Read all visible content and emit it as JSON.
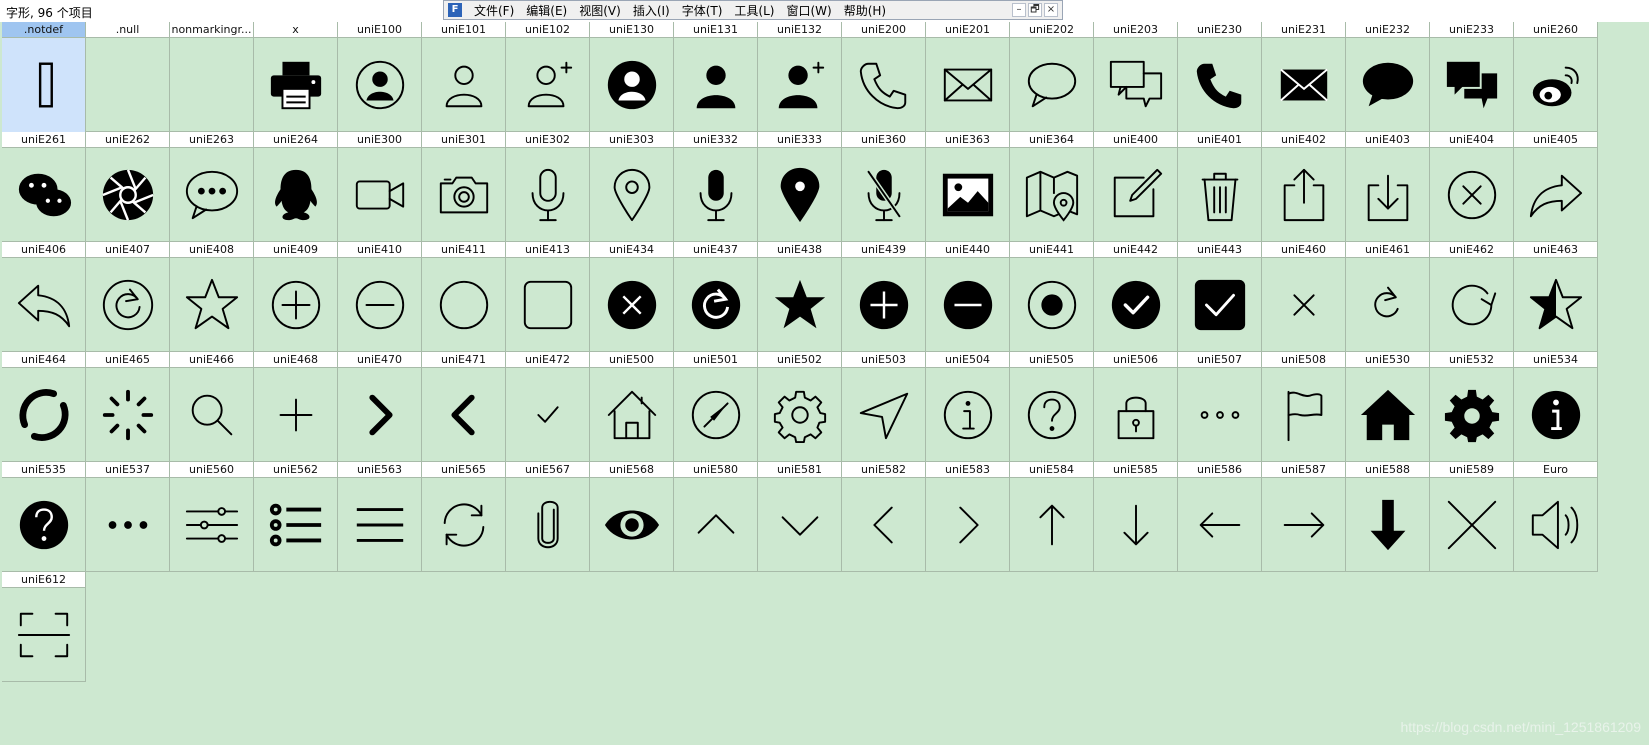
{
  "window": {
    "title": "字形, 96 个项目",
    "app_icon": "F",
    "menu": [
      "文件(F)",
      "编辑(E)",
      "视图(V)",
      "插入(I)",
      "字体(T)",
      "工具(L)",
      "窗口(W)",
      "帮助(H)"
    ],
    "controls": {
      "minimize": "–",
      "restore": "🗗",
      "close": "×"
    }
  },
  "glyphs": [
    {
      "label": ".notdef",
      "icon": "notdef-box"
    },
    {
      "label": ".null",
      "icon": "empty"
    },
    {
      "label": "nonmarkingr...",
      "icon": "empty"
    },
    {
      "label": "x",
      "icon": "printer"
    },
    {
      "label": "uniE100",
      "icon": "user-circle-outline"
    },
    {
      "label": "uniE101",
      "icon": "user-outline"
    },
    {
      "label": "uniE102",
      "icon": "user-add-outline"
    },
    {
      "label": "uniE130",
      "icon": "user-circle-filled"
    },
    {
      "label": "uniE131",
      "icon": "user-filled"
    },
    {
      "label": "uniE132",
      "icon": "user-add-filled"
    },
    {
      "label": "uniE200",
      "icon": "phone-outline"
    },
    {
      "label": "uniE201",
      "icon": "mail-outline"
    },
    {
      "label": "uniE202",
      "icon": "chat-outline"
    },
    {
      "label": "uniE203",
      "icon": "chats-outline"
    },
    {
      "label": "uniE230",
      "icon": "phone-filled"
    },
    {
      "label": "uniE231",
      "icon": "mail-filled"
    },
    {
      "label": "uniE232",
      "icon": "chat-filled"
    },
    {
      "label": "uniE233",
      "icon": "chats-filled"
    },
    {
      "label": "uniE260",
      "icon": "weibo"
    },
    {
      "label": "uniE261",
      "icon": "wechat"
    },
    {
      "label": "uniE262",
      "icon": "aperture"
    },
    {
      "label": "uniE263",
      "icon": "chat-dots"
    },
    {
      "label": "uniE264",
      "icon": "qq"
    },
    {
      "label": "uniE300",
      "icon": "video-camera"
    },
    {
      "label": "uniE301",
      "icon": "camera"
    },
    {
      "label": "uniE302",
      "icon": "mic-outline"
    },
    {
      "label": "uniE303",
      "icon": "location-outline"
    },
    {
      "label": "uniE332",
      "icon": "mic-filled"
    },
    {
      "label": "uniE333",
      "icon": "location-filled"
    },
    {
      "label": "uniE360",
      "icon": "mic-off"
    },
    {
      "label": "uniE363",
      "icon": "image"
    },
    {
      "label": "uniE364",
      "icon": "map"
    },
    {
      "label": "uniE400",
      "icon": "edit"
    },
    {
      "label": "uniE401",
      "icon": "trash"
    },
    {
      "label": "uniE402",
      "icon": "upload"
    },
    {
      "label": "uniE403",
      "icon": "download"
    },
    {
      "label": "uniE404",
      "icon": "close-circle-outline"
    },
    {
      "label": "uniE405",
      "icon": "share"
    },
    {
      "label": "uniE406",
      "icon": "undo"
    },
    {
      "label": "uniE407",
      "icon": "refresh-circle-outline"
    },
    {
      "label": "uniE408",
      "icon": "star-outline"
    },
    {
      "label": "uniE409",
      "icon": "plus-circle-outline"
    },
    {
      "label": "uniE410",
      "icon": "minus-circle-outline"
    },
    {
      "label": "uniE411",
      "icon": "circle-outline"
    },
    {
      "label": "uniE413",
      "icon": "square-outline"
    },
    {
      "label": "uniE434",
      "icon": "close-circle-filled"
    },
    {
      "label": "uniE437",
      "icon": "refresh-circle-filled"
    },
    {
      "label": "uniE438",
      "icon": "star-filled"
    },
    {
      "label": "uniE439",
      "icon": "plus-circle-filled"
    },
    {
      "label": "uniE440",
      "icon": "minus-circle-filled"
    },
    {
      "label": "uniE441",
      "icon": "radio-checked"
    },
    {
      "label": "uniE442",
      "icon": "check-circle-filled"
    },
    {
      "label": "uniE443",
      "icon": "checkbox-checked"
    },
    {
      "label": "uniE460",
      "icon": "close"
    },
    {
      "label": "uniE461",
      "icon": "refresh"
    },
    {
      "label": "uniE462",
      "icon": "loop"
    },
    {
      "label": "uniE463",
      "icon": "star-half"
    },
    {
      "label": "uniE464",
      "icon": "loading-arcs"
    },
    {
      "label": "uniE465",
      "icon": "spinner"
    },
    {
      "label": "uniE466",
      "icon": "search"
    },
    {
      "label": "uniE468",
      "icon": "plus"
    },
    {
      "label": "uniE470",
      "icon": "chevron-right-bold"
    },
    {
      "label": "uniE471",
      "icon": "chevron-left-bold"
    },
    {
      "label": "uniE472",
      "icon": "checkmark"
    },
    {
      "label": "uniE500",
      "icon": "home-outline"
    },
    {
      "label": "uniE501",
      "icon": "compass"
    },
    {
      "label": "uniE502",
      "icon": "gear-outline"
    },
    {
      "label": "uniE503",
      "icon": "navigate"
    },
    {
      "label": "uniE504",
      "icon": "info-outline"
    },
    {
      "label": "uniE505",
      "icon": "help-outline"
    },
    {
      "label": "uniE506",
      "icon": "lock"
    },
    {
      "label": "uniE507",
      "icon": "more-outline"
    },
    {
      "label": "uniE508",
      "icon": "flag"
    },
    {
      "label": "uniE530",
      "icon": "home-filled"
    },
    {
      "label": "uniE532",
      "icon": "gear-filled"
    },
    {
      "label": "uniE534",
      "icon": "info-filled"
    },
    {
      "label": "uniE535",
      "icon": "help-filled"
    },
    {
      "label": "uniE537",
      "icon": "more-filled"
    },
    {
      "label": "uniE560",
      "icon": "sliders"
    },
    {
      "label": "uniE562",
      "icon": "list"
    },
    {
      "label": "uniE563",
      "icon": "menu"
    },
    {
      "label": "uniE565",
      "icon": "sync"
    },
    {
      "label": "uniE567",
      "icon": "paperclip"
    },
    {
      "label": "uniE568",
      "icon": "eye"
    },
    {
      "label": "uniE580",
      "icon": "arrow-up-chevron"
    },
    {
      "label": "uniE581",
      "icon": "arrow-down-chevron"
    },
    {
      "label": "uniE582",
      "icon": "arrow-left-chevron"
    },
    {
      "label": "uniE583",
      "icon": "arrow-right-chevron"
    },
    {
      "label": "uniE584",
      "icon": "arrow-up"
    },
    {
      "label": "uniE585",
      "icon": "arrow-down"
    },
    {
      "label": "uniE586",
      "icon": "arrow-left"
    },
    {
      "label": "uniE587",
      "icon": "arrow-right"
    },
    {
      "label": "uniE588",
      "icon": "arrow-down-bold"
    },
    {
      "label": "uniE589",
      "icon": "close-large"
    },
    {
      "label": "Euro",
      "icon": "speaker"
    },
    {
      "label": "uniE612",
      "icon": "scan"
    }
  ],
  "watermark": "https://blog.csdn.net/mini_1251861209",
  "colors": {
    "background": "#cde8d0",
    "selected": "#cfe3fb",
    "glyph": "#000000"
  }
}
